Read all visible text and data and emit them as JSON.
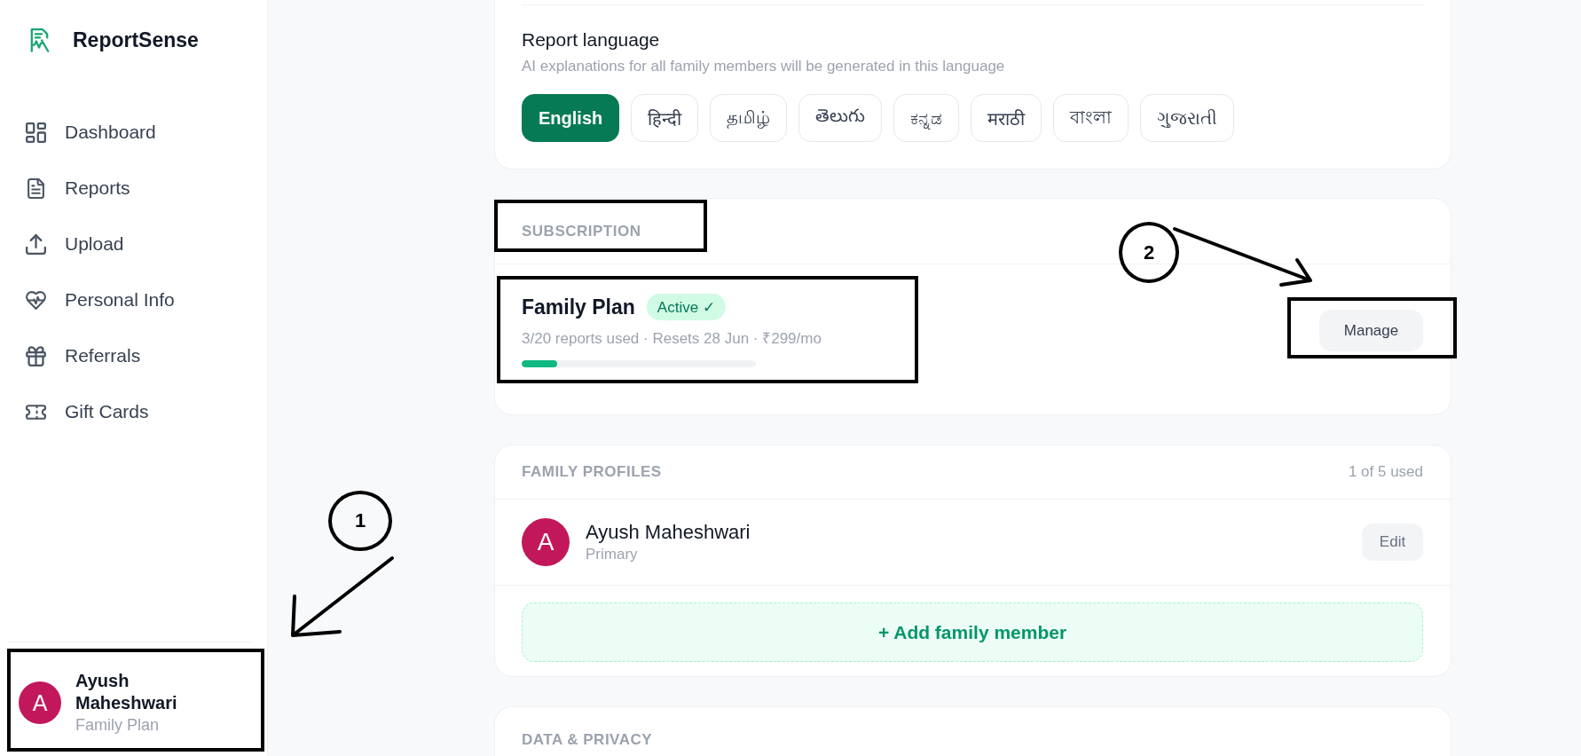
{
  "sidebar": {
    "brand": "ReportSense",
    "items": [
      {
        "label": "Dashboard",
        "selected": false
      },
      {
        "label": "Reports",
        "selected": false
      },
      {
        "label": "Upload",
        "selected": false
      },
      {
        "label": "Personal Info",
        "selected": false
      },
      {
        "label": "Referrals",
        "selected": false
      },
      {
        "label": "Gift Cards",
        "selected": false
      }
    ],
    "user": {
      "initial": "A",
      "name": "Ayush Maheshwari",
      "plan": "Family Plan"
    }
  },
  "report_language": {
    "title": "Report language",
    "subtitle": "AI explanations for all family members will be generated in this language",
    "options": [
      {
        "label": "English",
        "selected": true
      },
      {
        "label": "हिन्दी",
        "selected": false
      },
      {
        "label": "தமிழ்",
        "selected": false
      },
      {
        "label": "తెలుగు",
        "selected": false
      },
      {
        "label": "ಕನ್ನಡ",
        "selected": false
      },
      {
        "label": "मराठी",
        "selected": false
      },
      {
        "label": "বাংলা",
        "selected": false
      },
      {
        "label": "ગુજરાતી",
        "selected": false
      }
    ]
  },
  "subscription": {
    "heading": "SUBSCRIPTION",
    "plan_name": "Family Plan",
    "status": "Active ✓",
    "usage": "3/20 reports used · Resets 28 Jun · ₹299/mo",
    "level": 0.15,
    "button": "Manage"
  },
  "family_profiles": {
    "heading": "FAMILY PROFILES",
    "count": "1 of 5 used",
    "members": [
      {
        "initial": "A",
        "name": "Ayush Maheshwari",
        "role": "Primary",
        "button": "Edit"
      }
    ],
    "add_button": "+ Add family member"
  },
  "data_privacy": {
    "heading": "DATA & PRIVACY"
  },
  "annotations": [
    {
      "number": "1"
    },
    {
      "number": "2"
    }
  ]
}
